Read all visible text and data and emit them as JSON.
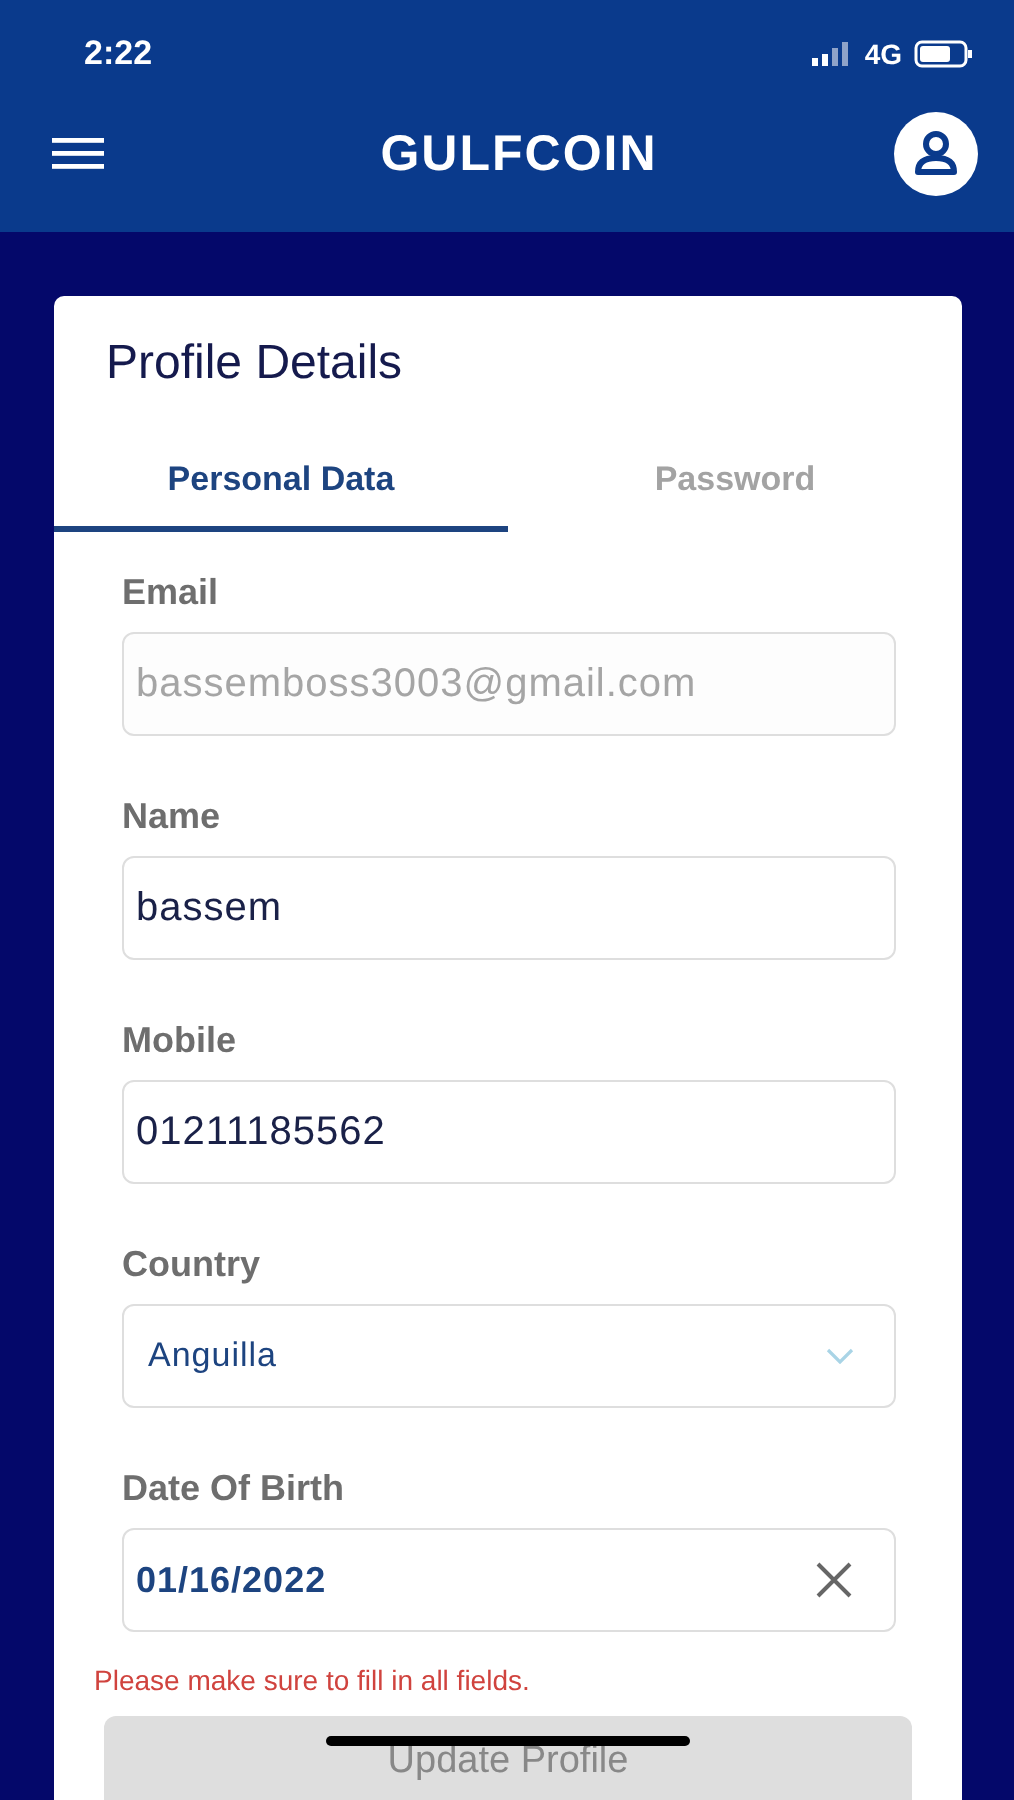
{
  "status_bar": {
    "time": "2:22",
    "network": "4G"
  },
  "app_bar": {
    "logo": "GULFCOIN"
  },
  "card": {
    "title": "Profile Details",
    "tabs": [
      {
        "label": "Personal Data",
        "selected": true
      },
      {
        "label": "Password",
        "selected": false
      }
    ],
    "fields": [
      {
        "kind": "text",
        "label": "Email",
        "value": "bassemboss3003@gmail.com",
        "disabled": true
      },
      {
        "kind": "text",
        "label": "Name",
        "value": "bassem",
        "disabled": false
      },
      {
        "kind": "text",
        "label": "Mobile",
        "value": "01211185562",
        "disabled": false
      },
      {
        "kind": "select",
        "label": "Country",
        "value": "Anguilla"
      },
      {
        "kind": "date",
        "label": "Date Of Birth",
        "value": "01/16/2022"
      }
    ],
    "error": "Please make sure to fill in all fields.",
    "button": "Update Profile"
  }
}
